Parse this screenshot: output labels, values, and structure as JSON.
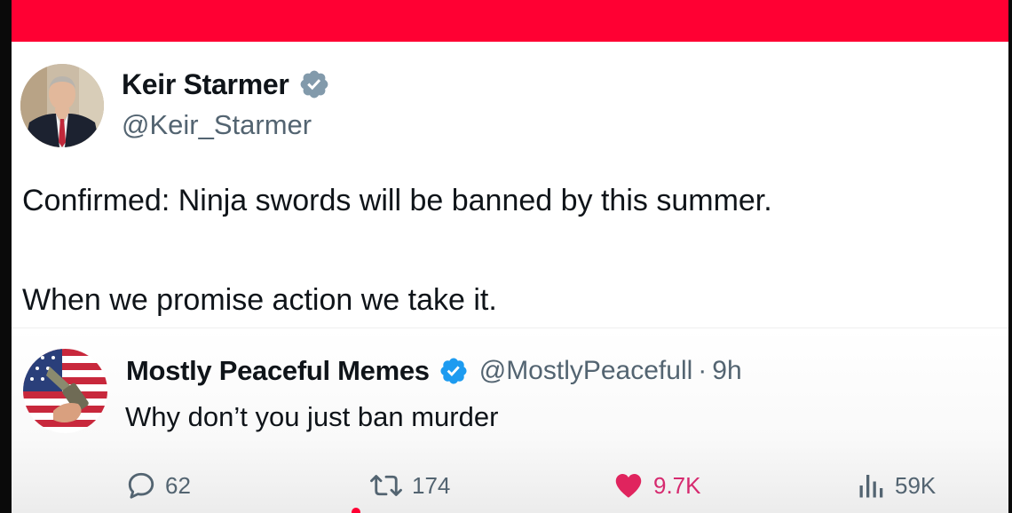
{
  "colors": {
    "banner": "#ff0033",
    "verified_main": "#829aab",
    "verified_reply": "#1d9bf0",
    "like": "#e0245e",
    "text": "#0f1419",
    "muted": "#536471"
  },
  "main_tweet": {
    "author_name": "Keir Starmer",
    "author_handle": "@Keir_Starmer",
    "avatar": "profile-photo",
    "verified_icon": "verified-badge-gray",
    "lines": [
      "Confirmed: Ninja swords will be banned by this summer.",
      "When we promise action we take it."
    ]
  },
  "reply": {
    "author_name": "Mostly Peaceful Memes",
    "author_handle": "@MostlyPeacefull",
    "separator": "·",
    "time": "9h",
    "avatar": "flag-avatar",
    "verified_icon": "verified-badge-blue",
    "text": "Why don’t you just ban murder",
    "actions": {
      "replies": {
        "icon": "comment-icon",
        "count": "62"
      },
      "reposts": {
        "icon": "retweet-icon",
        "count": "174"
      },
      "likes": {
        "icon": "heart-icon",
        "count": "9.7K"
      },
      "views": {
        "icon": "views-icon",
        "count": "59K"
      }
    }
  }
}
